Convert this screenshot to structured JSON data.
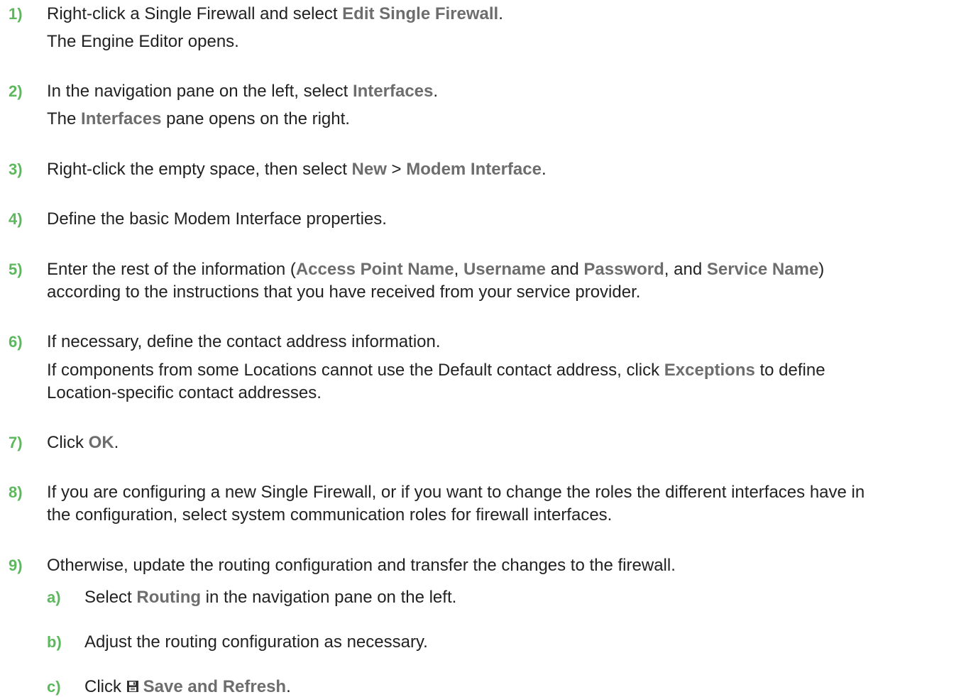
{
  "colors": {
    "step_number": "#5cb85c",
    "ui_term": "#6d6d6d",
    "text": "#222222"
  },
  "steps": [
    {
      "num": "1)",
      "line1": {
        "a": "Right-click a Single Firewall and select ",
        "b": "Edit Single Firewall",
        "c": "."
      },
      "line2": "The Engine Editor opens."
    },
    {
      "num": "2)",
      "line1": {
        "a": "In the navigation pane on the left, select ",
        "b": "Interfaces",
        "c": "."
      },
      "line2": {
        "a": "The ",
        "b": "Interfaces",
        "c": " pane opens on the right."
      }
    },
    {
      "num": "3)",
      "line1": {
        "a": "Right-click the empty space, then select ",
        "b": "New",
        "c": " > ",
        "d": "Modem Interface",
        "e": "."
      }
    },
    {
      "num": "4)",
      "line1": "Define the basic Modem Interface properties."
    },
    {
      "num": "5)",
      "line1": {
        "a": "Enter the rest of the information (",
        "b": "Access Point Name",
        "c": ", ",
        "d": "Username",
        "e": " and ",
        "f": "Password",
        "g": ", and ",
        "h": "Service Name",
        "i": ")"
      },
      "line2": "according to the instructions that you have received from your service provider."
    },
    {
      "num": "6)",
      "line1": "If necessary, define the contact address information.",
      "line2": {
        "a": "If components from some Locations cannot use the Default contact address, click ",
        "b": "Exceptions",
        "c": " to define"
      },
      "line3": "Location-specific contact addresses."
    },
    {
      "num": "7)",
      "line1": {
        "a": "Click ",
        "b": "OK",
        "c": "."
      }
    },
    {
      "num": "8)",
      "line1": "If you are configuring a new Single Firewall, or if you want to change the roles the different interfaces have in",
      "line2": "the configuration, select system communication roles for firewall interfaces."
    },
    {
      "num": "9)",
      "line1": "Otherwise, update the routing configuration and transfer the changes to the firewall."
    }
  ],
  "substeps": [
    {
      "num": "a)",
      "line1": {
        "a": "Select ",
        "b": "Routing",
        "c": " in the navigation pane on the left."
      }
    },
    {
      "num": "b)",
      "line1": "Adjust the routing configuration as necessary."
    },
    {
      "num": "c)",
      "line1": {
        "a": "Click ",
        "icon": "save-icon",
        "b": "Save and Refresh",
        "c": "."
      }
    }
  ]
}
